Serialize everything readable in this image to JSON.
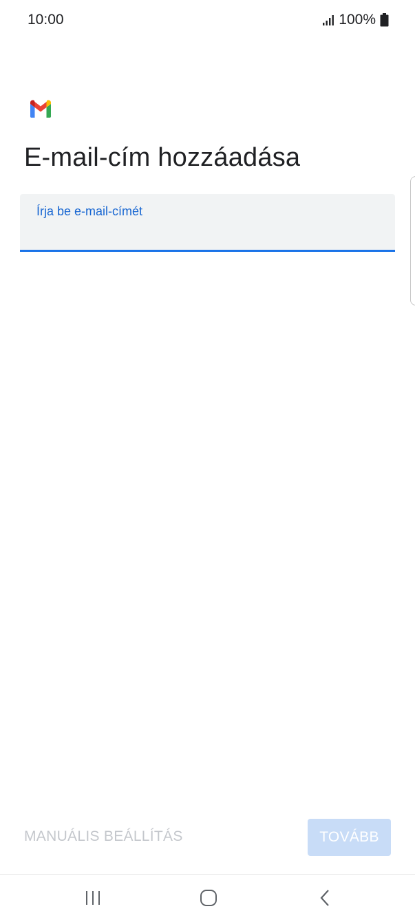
{
  "status_bar": {
    "time": "10:00",
    "battery": "100%"
  },
  "icons": {
    "logo": "gmail-logo-icon",
    "signal": "signal-icon",
    "battery": "battery-icon",
    "recents": "recents-icon",
    "home": "home-icon",
    "back": "back-icon"
  },
  "page": {
    "title": "E-mail-cím hozzáadása"
  },
  "email_field": {
    "label": "Írja be e-mail-címét",
    "value": ""
  },
  "actions": {
    "manual_setup_label": "MANUÁLIS BEÁLLÍTÁS",
    "next_label": "TOVÁBB"
  },
  "colors": {
    "accent": "#1a73e8",
    "next_button_disabled_bg": "#c8dcf7",
    "disabled_text": "#c4c7cc",
    "field_bg": "#f1f3f4"
  }
}
